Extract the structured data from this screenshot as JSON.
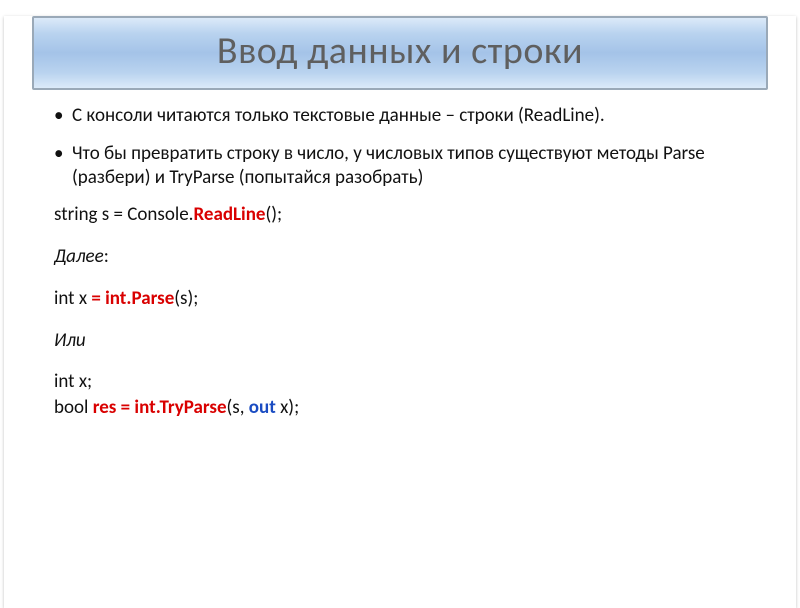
{
  "title": "Ввод данных и строки",
  "bullets": [
    "С консоли читаются только текстовые данные – строки (ReadLine).",
    "Что бы превратить строку в число, у числовых типов существуют методы Parse (разбери) и TryParse (попытайся разобрать)"
  ],
  "code": {
    "line1_prefix": "string s = Console.",
    "line1_highlight": "ReadLine",
    "line1_suffix": "();",
    "next_label": "Далее",
    "colon": ":",
    "line2_prefix": "int x ",
    "line2_highlight": "= int.Parse",
    "line2_suffix": "(s);",
    "or_label": "Или",
    "line3": "int x;",
    "line4_prefix": "bool ",
    "line4_res": "res = int.TryParse",
    "line4_mid": "(s, ",
    "line4_out": "out ",
    "line4_suffix": "x);"
  }
}
